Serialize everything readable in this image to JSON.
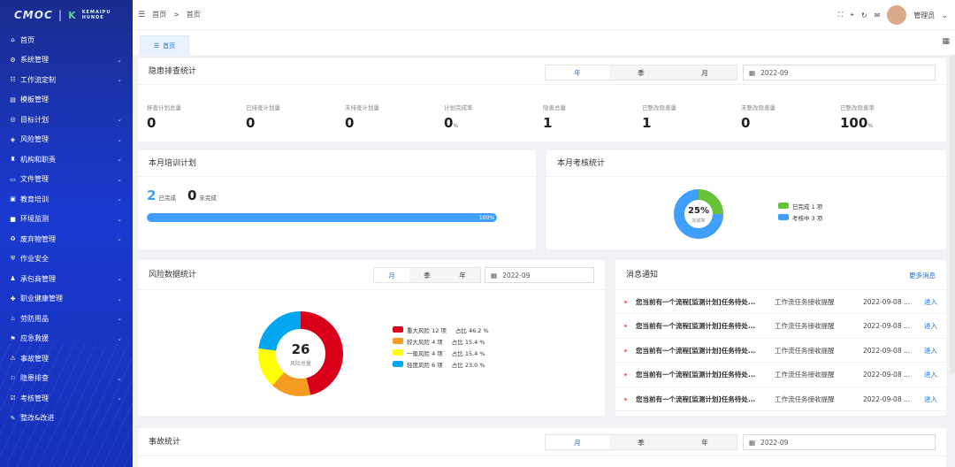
{
  "sidebar": {
    "logo_left": "CMOC",
    "logo_right": "K",
    "logo_right_small": "KEMAIPU HUNDE",
    "items": [
      {
        "label": "首页",
        "icon": "home-icon",
        "glyph": "⌂",
        "expandable": false
      },
      {
        "label": "系统管理",
        "icon": "gear-icon",
        "glyph": "⚙",
        "expandable": true
      },
      {
        "label": "工作流定制",
        "icon": "flow-icon",
        "glyph": "☷",
        "expandable": true
      },
      {
        "label": "模板管理",
        "icon": "template-icon",
        "glyph": "▤",
        "expandable": false
      },
      {
        "label": "目标计划",
        "icon": "target-icon",
        "glyph": "◎",
        "expandable": true
      },
      {
        "label": "风险管理",
        "icon": "risk-icon",
        "glyph": "◈",
        "expandable": true
      },
      {
        "label": "机构和职责",
        "icon": "org-icon",
        "glyph": "♜",
        "expandable": true
      },
      {
        "label": "文件管理",
        "icon": "file-icon",
        "glyph": "▭",
        "expandable": true
      },
      {
        "label": "教育培训",
        "icon": "training-icon",
        "glyph": "▣",
        "expandable": true
      },
      {
        "label": "环境监测",
        "icon": "monitor-icon",
        "glyph": "■",
        "expandable": true
      },
      {
        "label": "废弃物管理",
        "icon": "waste-icon",
        "glyph": "♻",
        "expandable": true
      },
      {
        "label": "作业安全",
        "icon": "shield-icon",
        "glyph": "⛨",
        "expandable": false
      },
      {
        "label": "承包商管理",
        "icon": "contractor-icon",
        "glyph": "♟",
        "expandable": true
      },
      {
        "label": "职业健康管理",
        "icon": "health-icon",
        "glyph": "✚",
        "expandable": true
      },
      {
        "label": "劳防用品",
        "icon": "ppe-icon",
        "glyph": "♨",
        "expandable": true
      },
      {
        "label": "应急救援",
        "icon": "emergency-icon",
        "glyph": "⚑",
        "expandable": true
      },
      {
        "label": "事故管理",
        "icon": "accident-icon",
        "glyph": "⚠",
        "expandable": false
      },
      {
        "label": "隐患排查",
        "icon": "hazard-icon",
        "glyph": "⚐",
        "expandable": true
      },
      {
        "label": "考核管理",
        "icon": "assess-icon",
        "glyph": "☑",
        "expandable": true
      },
      {
        "label": "整改&改进",
        "icon": "rectify-icon",
        "glyph": "✎",
        "expandable": false
      }
    ]
  },
  "topbar": {
    "breadcrumb_root": "首页",
    "breadcrumb_sep": ">",
    "breadcrumb_current": "首页",
    "user_name": "管理员"
  },
  "tabs": {
    "home": "首页"
  },
  "hazard": {
    "title": "隐患排查统计",
    "seg": [
      "年",
      "季",
      "月"
    ],
    "date": "2022-09",
    "stats": [
      {
        "label": "排查计划总量",
        "value": "0",
        "unit": ""
      },
      {
        "label": "已排查计划量",
        "value": "0",
        "unit": ""
      },
      {
        "label": "未排查计划量",
        "value": "0",
        "unit": ""
      },
      {
        "label": "计划完成率",
        "value": "0",
        "unit": "%"
      },
      {
        "label": "隐患总量",
        "value": "1",
        "unit": ""
      },
      {
        "label": "已整改隐患量",
        "value": "1",
        "unit": ""
      },
      {
        "label": "未整改隐患量",
        "value": "0",
        "unit": ""
      },
      {
        "label": "已整改隐患率",
        "value": "100",
        "unit": "%"
      }
    ]
  },
  "training": {
    "title": "本月培训计划",
    "done_value": "2",
    "done_label": "已完成",
    "undone_value": "0",
    "undone_label": "未完成",
    "progress_percent": 100,
    "progress_label": "100%"
  },
  "assessment": {
    "title": "本月考核统计",
    "center_value": "25%",
    "center_label": "完成率",
    "legend": [
      {
        "label": "已完成 1 项",
        "color": "#67c23a",
        "value": 1
      },
      {
        "label": "考核中 3 项",
        "color": "#409eff",
        "value": 3
      }
    ]
  },
  "risk": {
    "title": "风险数据统计",
    "seg": [
      "月",
      "季",
      "年"
    ],
    "date": "2022-09",
    "center_value": "26",
    "center_label": "风险总量",
    "legend": [
      {
        "label": "重大风险 12 项",
        "share": "占比 46.2 %",
        "color": "#d9001b",
        "value": 12
      },
      {
        "label": "较大风险 4 项",
        "share": "占比 15.4 %",
        "color": "#f59a23",
        "value": 4
      },
      {
        "label": "一般风险 4 项",
        "share": "占比 15.4 %",
        "color": "#ffff00",
        "value": 4
      },
      {
        "label": "轻度风险 6 项",
        "share": "占比 23.0 %",
        "color": "#02a7f0",
        "value": 6
      }
    ]
  },
  "messages": {
    "title": "消息通知",
    "more": "更多消息",
    "rows": [
      {
        "title": "您当前有一个流程[监测计划]任务待处...",
        "category": "工作流任务接收提醒",
        "date": "2022-09-08 ...",
        "link": "进入"
      },
      {
        "title": "您当前有一个流程[监测计划]任务待处...",
        "category": "工作流任务接收提醒",
        "date": "2022-09-08 ...",
        "link": "进入"
      },
      {
        "title": "您当前有一个流程[监测计划]任务待处...",
        "category": "工作流任务接收提醒",
        "date": "2022-09-08 ...",
        "link": "进入"
      },
      {
        "title": "您当前有一个流程[监测计划]任务待处...",
        "category": "工作流任务接收提醒",
        "date": "2022-09-08 ...",
        "link": "进入"
      },
      {
        "title": "您当前有一个流程[监测计划]任务待处...",
        "category": "工作流任务接收提醒",
        "date": "2022-09-08 ...",
        "link": "进入"
      }
    ]
  },
  "accident": {
    "title": "事故统计",
    "seg": [
      "月",
      "季",
      "年"
    ],
    "date": "2022-09"
  },
  "colors": {
    "accent": "#1e6fd9",
    "progress": "#409eff"
  }
}
